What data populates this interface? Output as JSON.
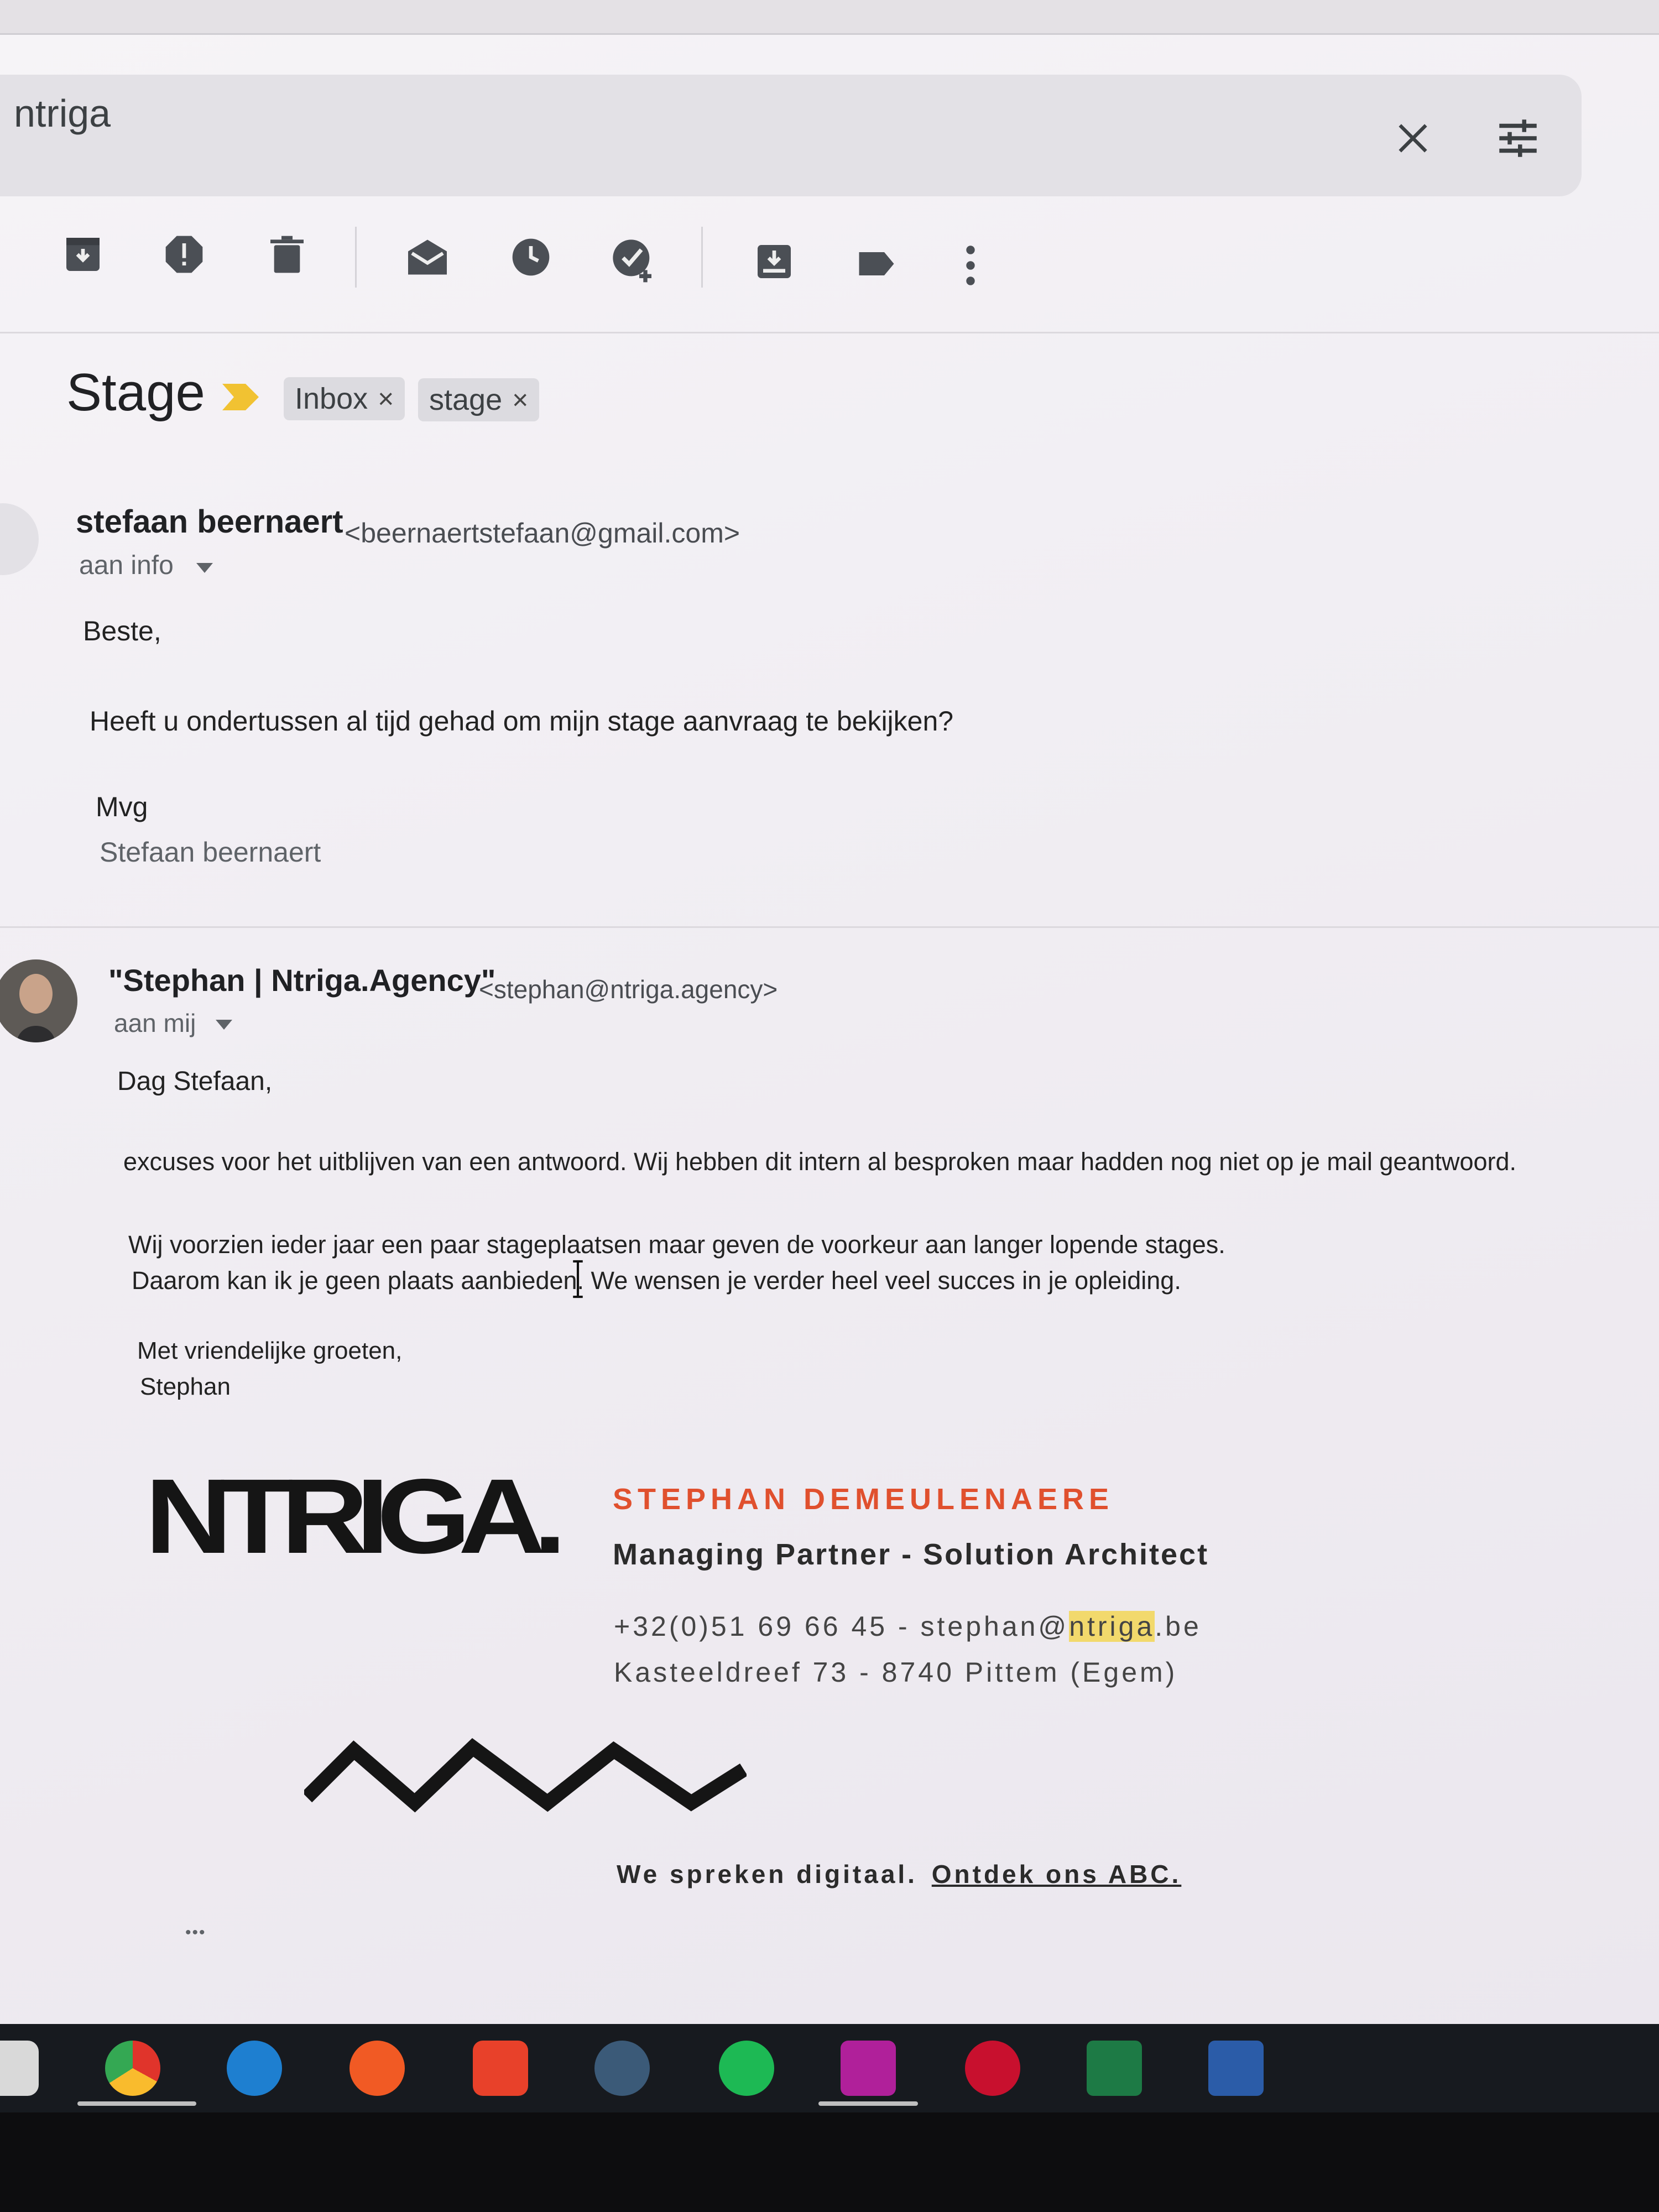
{
  "search": {
    "query": "ntriga"
  },
  "toolbar": {
    "icons": [
      "archive-icon",
      "report-spam-icon",
      "delete-icon",
      "mark-unread-icon",
      "snooze-icon",
      "add-to-tasks-icon",
      "move-to-icon",
      "label-icon",
      "more-vert-icon"
    ]
  },
  "thread": {
    "subject": "Stage",
    "labels": [
      {
        "text": "Inbox",
        "remove": "×"
      },
      {
        "text": "stage",
        "remove": "×"
      }
    ]
  },
  "message1": {
    "sender_name": "stefaan beernaert",
    "sender_email": "<beernaertstefaan@gmail.com>",
    "recipient": "aan info",
    "greeting": "Beste,",
    "line1": "Heeft u ondertussen al tijd gehad om mijn stage aanvraag te bekijken?",
    "closing": "Mvg",
    "signature": "Stefaan beernaert"
  },
  "message2": {
    "sender_name": "\"Stephan | Ntriga.Agency\"",
    "sender_email": "<stephan@ntriga.agency>",
    "recipient": "aan mij",
    "greeting": "Dag Stefaan,",
    "line1": "excuses voor het uitblijven van een antwoord. Wij hebben dit intern al besproken maar hadden nog niet op je mail geantwoord.",
    "line2": "Wij voorzien ieder jaar een paar stageplaatsen maar geven de voorkeur aan langer lopende stages.",
    "line3": "Daarom kan ik je geen plaats aanbieden. We wensen je verder heel veel succes in je opleiding.",
    "closing": "Met vriendelijke groeten,",
    "signoff": "Stephan",
    "sig": {
      "logo": "NTRIGA.",
      "name": "STEPHAN DEMEULENAERE",
      "role": "Managing Partner - Solution Architect",
      "phone": "+32(0)51 69 66 45",
      "dash": " - ",
      "email_prefix": "stephan@",
      "email_hl": "ntriga",
      "email_suffix": ".be",
      "address": "Kasteeldreef 73 - 8740 Pittem (Egem)",
      "tagline": "We spreken digitaal.",
      "tagline_link": "Ontdek ons ABC."
    },
    "trimmed": "•••"
  },
  "taskbar": {
    "apps": [
      "chrome",
      "edge",
      "firefox",
      "brave",
      "steam",
      "spotify",
      "phpstorm",
      "winamp",
      "excel",
      "word"
    ],
    "colors": {
      "chrome": "#e0342b",
      "edge": "#1e7fd0",
      "firefox": "#f15a24",
      "brave": "#e8412a",
      "steam": "#3b5a78",
      "spotify": "#1db954",
      "phpstorm": "#b0209a",
      "winamp": "#c8102e",
      "excel": "#1d7a45",
      "word": "#2b5ca8"
    }
  }
}
